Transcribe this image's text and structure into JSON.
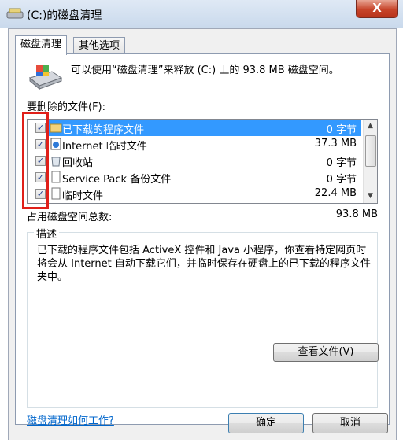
{
  "window": {
    "title": "(C:)的磁盘清理",
    "close_symbol": "X"
  },
  "tabs": [
    {
      "label": "磁盘清理",
      "active": true
    },
    {
      "label": "其他选项",
      "active": false
    }
  ],
  "summary": "可以使用“磁盘清理”来释放 (C:) 上的 93.8 MB 磁盘空间。",
  "files_label": "要删除的文件(F):",
  "files": [
    {
      "name": "已下载的程序文件",
      "size": "0 字节",
      "checked": true,
      "selected": true,
      "icon": "folder-icon"
    },
    {
      "name": "Internet 临时文件",
      "size": "37.3 MB",
      "checked": true,
      "selected": false,
      "icon": "internet-page-icon"
    },
    {
      "name": "回收站",
      "size": "0 字节",
      "checked": true,
      "selected": false,
      "icon": "recycle-bin-icon"
    },
    {
      "name": "Service Pack 备份文件",
      "size": "0 字节",
      "checked": true,
      "selected": false,
      "icon": "backup-file-icon"
    },
    {
      "name": "临时文件",
      "size": "22.4 MB",
      "checked": true,
      "selected": false,
      "icon": "temp-file-icon"
    }
  ],
  "total_label": "占用磁盘空间总数:",
  "total_value": "93.8 MB",
  "description": {
    "title": "描述",
    "text": "已下载的程序文件包括 ActiveX 控件和 Java 小程序，你查看特定网页时将会从 Internet 自动下载它们，并临时保存在硬盘上的已下载的程序文件夹中。"
  },
  "view_files_button": "查看文件(V)",
  "help_link": "磁盘清理如何工作?",
  "ok_button": "确定",
  "cancel_button": "取消",
  "colors": {
    "selection": "#3399ff",
    "highlight_box": "#e0201a",
    "link": "#0066cc"
  }
}
